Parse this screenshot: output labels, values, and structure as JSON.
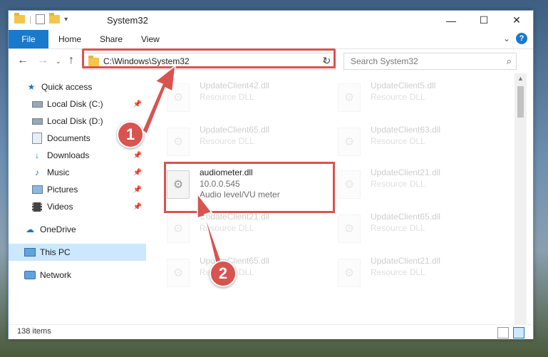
{
  "window": {
    "title": "System32",
    "controls": {
      "minimize": "—",
      "maximize": "☐",
      "close": "✕"
    }
  },
  "ribbon": {
    "tabs": [
      "File",
      "Home",
      "Share",
      "View"
    ],
    "collapse_icon": "⌄",
    "help_label": "?"
  },
  "navigation": {
    "address_path": "C:\\Windows\\System32",
    "search_placeholder": "Search System32"
  },
  "sidebar": {
    "items": [
      {
        "label": "Quick access",
        "icon": "star-icon"
      },
      {
        "label": "Local Disk (C:)",
        "icon": "drive-icon",
        "pinned": true
      },
      {
        "label": "Local Disk (D:)",
        "icon": "drive-icon"
      },
      {
        "label": "Documents",
        "icon": "documents-icon"
      },
      {
        "label": "Downloads",
        "icon": "download-icon",
        "pinned": true
      },
      {
        "label": "Music",
        "icon": "music-icon",
        "pinned": true
      },
      {
        "label": "Pictures",
        "icon": "pictures-icon",
        "pinned": true
      },
      {
        "label": "Videos",
        "icon": "videos-icon",
        "pinned": true
      },
      {
        "label": "OneDrive",
        "icon": "cloud-icon"
      },
      {
        "label": "This PC",
        "icon": "computer-icon",
        "selected": true
      },
      {
        "label": "Network",
        "icon": "network-icon"
      }
    ]
  },
  "files": {
    "highlighted": {
      "name": "audiometer.dll",
      "version": "10.0.0.545",
      "description": "Audio level/VU meter"
    },
    "faded": [
      {
        "name": "UpdateClient42.dll",
        "type": "Resource DLL"
      },
      {
        "name": "UpdateClient5.dll",
        "type": "Resource DLL"
      },
      {
        "name": "UpdateClient65.dll",
        "type": "Resource DLL"
      },
      {
        "name": "UpdateClient63.dll",
        "type": "Resource DLL"
      },
      {
        "name": "UpdateClient21.dll",
        "type": "Resource DLL"
      },
      {
        "name": "UpdateClient21.dll",
        "type": "Resource DLL"
      },
      {
        "name": "UpdateClient65.dll",
        "type": "Resource DLL"
      },
      {
        "name": "UpdateClient65.dll",
        "type": "Resource DLL"
      },
      {
        "name": "UpdateClient21.dll",
        "type": "Resource DLL"
      }
    ]
  },
  "status": {
    "item_count": "138 items"
  },
  "annotations": {
    "step1": "1",
    "step2": "2",
    "color": "#d9534f"
  }
}
